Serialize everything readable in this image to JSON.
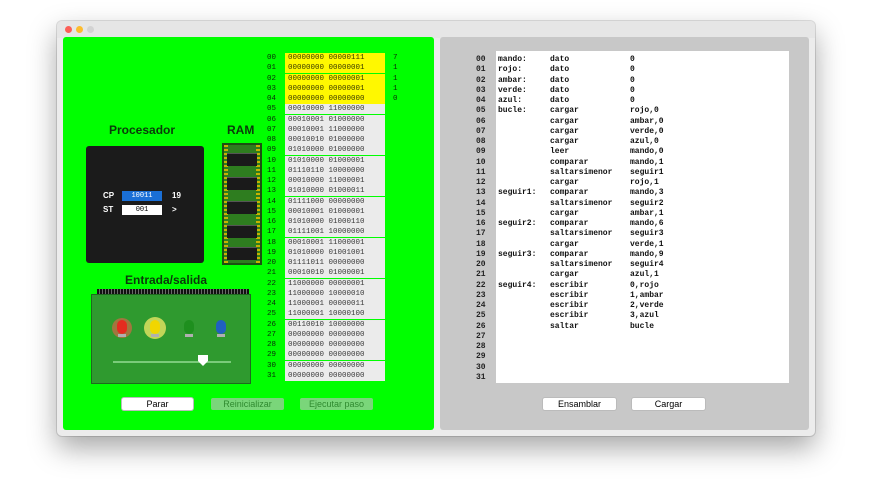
{
  "colors": {
    "panel_green": "#00ff00",
    "highlight_yellow": "#fff800",
    "cp_blue": "#1a6fd6",
    "panel_gray": "#c8c8c8"
  },
  "processor": {
    "title": "Procesador",
    "cp_label": "CP",
    "cp_value": "10011",
    "cp_decimal": "19",
    "st_label": "ST",
    "st_value": "001",
    "st_flag": ">"
  },
  "ram": {
    "title": "RAM"
  },
  "io": {
    "title": "Entrada/salida",
    "leds": [
      "red-led-on",
      "yellow-led-on",
      "green-led-off",
      "blue-led-off"
    ],
    "slider_value": 0.75
  },
  "memory": [
    {
      "addr": "00",
      "cells": "00000000 00000111",
      "dec": "7",
      "hl": true
    },
    {
      "addr": "01",
      "cells": "00000000 00000001",
      "dec": "1",
      "hl": true
    },
    {
      "addr": "02",
      "cells": "00000000 00000001",
      "dec": "1",
      "hl": true
    },
    {
      "addr": "03",
      "cells": "00000000 00000001",
      "dec": "1",
      "hl": true
    },
    {
      "addr": "04",
      "cells": "00000000 00000000",
      "dec": "0",
      "hl": true
    },
    {
      "addr": "05",
      "cells": "00010000 11000000",
      "dec": "",
      "hl": false
    },
    {
      "addr": "06",
      "cells": "00010001 01000000",
      "dec": "",
      "hl": false
    },
    {
      "addr": "07",
      "cells": "00010001 11000000",
      "dec": "",
      "hl": false
    },
    {
      "addr": "08",
      "cells": "00010010 01000000",
      "dec": "",
      "hl": false
    },
    {
      "addr": "09",
      "cells": "01010000 01000000",
      "dec": "",
      "hl": false
    },
    {
      "addr": "10",
      "cells": "01010000 01000001",
      "dec": "",
      "hl": false
    },
    {
      "addr": "11",
      "cells": "01110110 10000000",
      "dec": "",
      "hl": false
    },
    {
      "addr": "12",
      "cells": "00010000 11000001",
      "dec": "",
      "hl": false
    },
    {
      "addr": "13",
      "cells": "01010000 01000011",
      "dec": "",
      "hl": false
    },
    {
      "addr": "14",
      "cells": "01111000 00000000",
      "dec": "",
      "hl": false
    },
    {
      "addr": "15",
      "cells": "00010001 01000001",
      "dec": "",
      "hl": false
    },
    {
      "addr": "16",
      "cells": "01010000 01000110",
      "dec": "",
      "hl": false
    },
    {
      "addr": "17",
      "cells": "01111001 10000000",
      "dec": "",
      "hl": false
    },
    {
      "addr": "18",
      "cells": "00010001 11000001",
      "dec": "",
      "hl": false
    },
    {
      "addr": "19",
      "cells": "01010000 01001001",
      "dec": "",
      "hl": false
    },
    {
      "addr": "20",
      "cells": "01111011 00000000",
      "dec": "",
      "hl": false
    },
    {
      "addr": "21",
      "cells": "00010010 01000001",
      "dec": "",
      "hl": false
    },
    {
      "addr": "22",
      "cells": "11000000 00000001",
      "dec": "",
      "hl": false
    },
    {
      "addr": "23",
      "cells": "11000000 10000010",
      "dec": "",
      "hl": false
    },
    {
      "addr": "24",
      "cells": "11000001 00000011",
      "dec": "",
      "hl": false
    },
    {
      "addr": "25",
      "cells": "11000001 10000100",
      "dec": "",
      "hl": false
    },
    {
      "addr": "26",
      "cells": "00110010 10000000",
      "dec": "",
      "hl": false
    },
    {
      "addr": "27",
      "cells": "00000000 00000000",
      "dec": "",
      "hl": false
    },
    {
      "addr": "28",
      "cells": "00000000 00000000",
      "dec": "",
      "hl": false
    },
    {
      "addr": "29",
      "cells": "00000000 00000000",
      "dec": "",
      "hl": false
    },
    {
      "addr": "30",
      "cells": "00000000 00000000",
      "dec": "",
      "hl": false
    },
    {
      "addr": "31",
      "cells": "00000000 00000000",
      "dec": "",
      "hl": false
    }
  ],
  "buttons": {
    "stop": "Parar",
    "reset": "Reinicializar",
    "step": "Ejecutar paso",
    "assemble": "Ensamblar",
    "load": "Cargar"
  },
  "code": [
    {
      "n": "00",
      "lab": "mando:",
      "ins": "dato",
      "arg": "0"
    },
    {
      "n": "01",
      "lab": "rojo:",
      "ins": "dato",
      "arg": "0"
    },
    {
      "n": "02",
      "lab": "ambar:",
      "ins": "dato",
      "arg": "0"
    },
    {
      "n": "03",
      "lab": "verde:",
      "ins": "dato",
      "arg": "0"
    },
    {
      "n": "04",
      "lab": "azul:",
      "ins": "dato",
      "arg": "0"
    },
    {
      "n": "05",
      "lab": "bucle:",
      "ins": "cargar",
      "arg": "rojo,0"
    },
    {
      "n": "06",
      "lab": "",
      "ins": "cargar",
      "arg": "ambar,0"
    },
    {
      "n": "07",
      "lab": "",
      "ins": "cargar",
      "arg": "verde,0"
    },
    {
      "n": "08",
      "lab": "",
      "ins": "cargar",
      "arg": "azul,0"
    },
    {
      "n": "09",
      "lab": "",
      "ins": "leer",
      "arg": "mando,0"
    },
    {
      "n": "10",
      "lab": "",
      "ins": "comparar",
      "arg": "mando,1"
    },
    {
      "n": "11",
      "lab": "",
      "ins": "saltarsimenor",
      "arg": "seguir1"
    },
    {
      "n": "12",
      "lab": "",
      "ins": "cargar",
      "arg": "rojo,1"
    },
    {
      "n": "13",
      "lab": "seguir1:",
      "ins": "comparar",
      "arg": "mando,3"
    },
    {
      "n": "14",
      "lab": "",
      "ins": "saltarsimenor",
      "arg": "seguir2"
    },
    {
      "n": "15",
      "lab": "",
      "ins": "cargar",
      "arg": "ambar,1"
    },
    {
      "n": "16",
      "lab": "seguir2:",
      "ins": "comparar",
      "arg": "mando,6"
    },
    {
      "n": "17",
      "lab": "",
      "ins": "saltarsimenor",
      "arg": "seguir3"
    },
    {
      "n": "18",
      "lab": "",
      "ins": "cargar",
      "arg": "verde,1"
    },
    {
      "n": "19",
      "lab": "seguir3:",
      "ins": "comparar",
      "arg": "mando,9"
    },
    {
      "n": "20",
      "lab": "",
      "ins": "saltarsimenor",
      "arg": "seguir4"
    },
    {
      "n": "21",
      "lab": "",
      "ins": "cargar",
      "arg": "azul,1"
    },
    {
      "n": "22",
      "lab": "seguir4:",
      "ins": "escribir",
      "arg": "0,rojo"
    },
    {
      "n": "23",
      "lab": "",
      "ins": "escribir",
      "arg": "1,ambar"
    },
    {
      "n": "24",
      "lab": "",
      "ins": "escribir",
      "arg": "2,verde"
    },
    {
      "n": "25",
      "lab": "",
      "ins": "escribir",
      "arg": "3,azul"
    },
    {
      "n": "26",
      "lab": "",
      "ins": "saltar",
      "arg": "bucle"
    },
    {
      "n": "27",
      "lab": "",
      "ins": "",
      "arg": ""
    },
    {
      "n": "28",
      "lab": "",
      "ins": "",
      "arg": ""
    },
    {
      "n": "29",
      "lab": "",
      "ins": "",
      "arg": ""
    },
    {
      "n": "30",
      "lab": "",
      "ins": "",
      "arg": ""
    },
    {
      "n": "31",
      "lab": "",
      "ins": "",
      "arg": ""
    }
  ]
}
